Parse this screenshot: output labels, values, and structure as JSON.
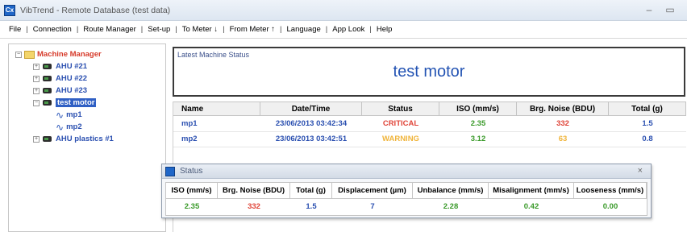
{
  "window": {
    "title": "VibTrend - Remote Database (test data)",
    "app_icon_text": "Cx"
  },
  "menu": [
    "File",
    "Connection",
    "Route Manager",
    "Set-up",
    "To Meter ↓",
    "From Meter ↑",
    "Language",
    "App Look",
    "Help"
  ],
  "menu_separator": "|",
  "tree": {
    "root": "Machine Manager",
    "machines": [
      "AHU #21",
      "AHU #22",
      "AHU #23",
      "test motor",
      "AHU plastics #1"
    ],
    "points": [
      "mp1",
      "mp2"
    ],
    "expand_collapsed": "+",
    "expand_open": "−"
  },
  "machine_status": {
    "label": "Latest Machine Status",
    "machine_name": "test motor"
  },
  "grid": {
    "columns": [
      "Name",
      "Date/Time",
      "Status",
      "ISO (mm/s)",
      "Brg. Noise (BDU)",
      "Total (g)"
    ],
    "rows": [
      {
        "name": "mp1",
        "datetime": "23/06/2013 03:42:34",
        "status": "CRITICAL",
        "iso": "2.35",
        "brg_noise": "332",
        "total": "1.5"
      },
      {
        "name": "mp2",
        "datetime": "23/06/2013 03:42:51",
        "status": "WARNING",
        "iso": "3.12",
        "brg_noise": "63",
        "total": "0.8"
      }
    ]
  },
  "status_dialog": {
    "title": "Status",
    "close": "×",
    "columns": [
      "ISO (mm/s)",
      "Brg. Noise (BDU)",
      "Total (g)",
      "Displacement (µm)",
      "Unbalance (mm/s)",
      "Misalignment (mm/s)",
      "Looseness (mm/s)"
    ],
    "values": [
      "2.35",
      "332",
      "1.5",
      "7",
      "2.28",
      "0.42",
      "0.00"
    ]
  },
  "colors": {
    "critical": "#e0463a",
    "warning": "#f0b43a",
    "ok": "#3a9a2a",
    "blue_text": "#2a4fb0"
  }
}
